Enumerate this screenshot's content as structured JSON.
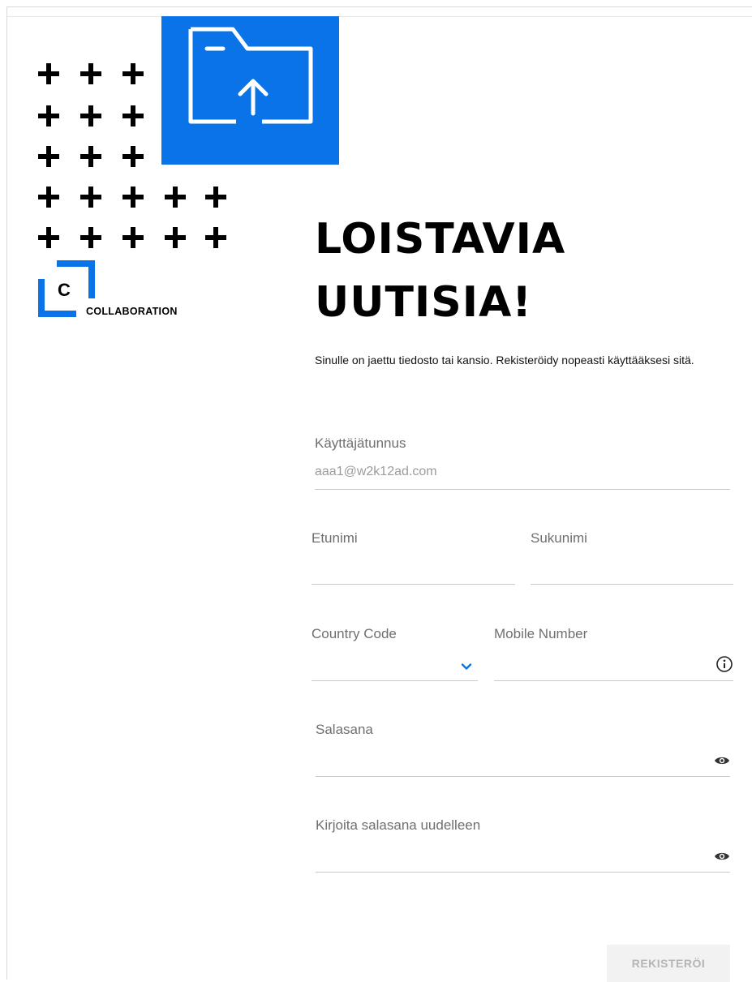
{
  "brand": {
    "logo_letter": "C",
    "logo_word": "COLLABORATION",
    "accent_color": "#0a73e8"
  },
  "hero_icon": "folder-upload-icon",
  "headline": {
    "line1": "LOISTAVIA",
    "line2": "UUTISIA!"
  },
  "intro_text": "Sinulle on jaettu tiedosto tai kansio. Rekisteröidy nopeasti käyttääksesi sitä.",
  "form": {
    "username": {
      "label": "Käyttäjätunnus",
      "value": "aaa1@w2k12ad.com"
    },
    "first_name": {
      "label": "Etunimi",
      "value": ""
    },
    "last_name": {
      "label": "Sukunimi",
      "value": ""
    },
    "country_code": {
      "label": "Country Code",
      "value": "",
      "icon": "chevron-down-icon"
    },
    "mobile_number": {
      "label": "Mobile Number",
      "value": "",
      "icon": "info-icon"
    },
    "password": {
      "label": "Salasana",
      "value": "",
      "icon": "eye-icon"
    },
    "password_confirm": {
      "label": "Kirjoita salasana uudelleen",
      "value": "",
      "icon": "eye-icon"
    },
    "submit_label": "REKISTERÖI"
  }
}
